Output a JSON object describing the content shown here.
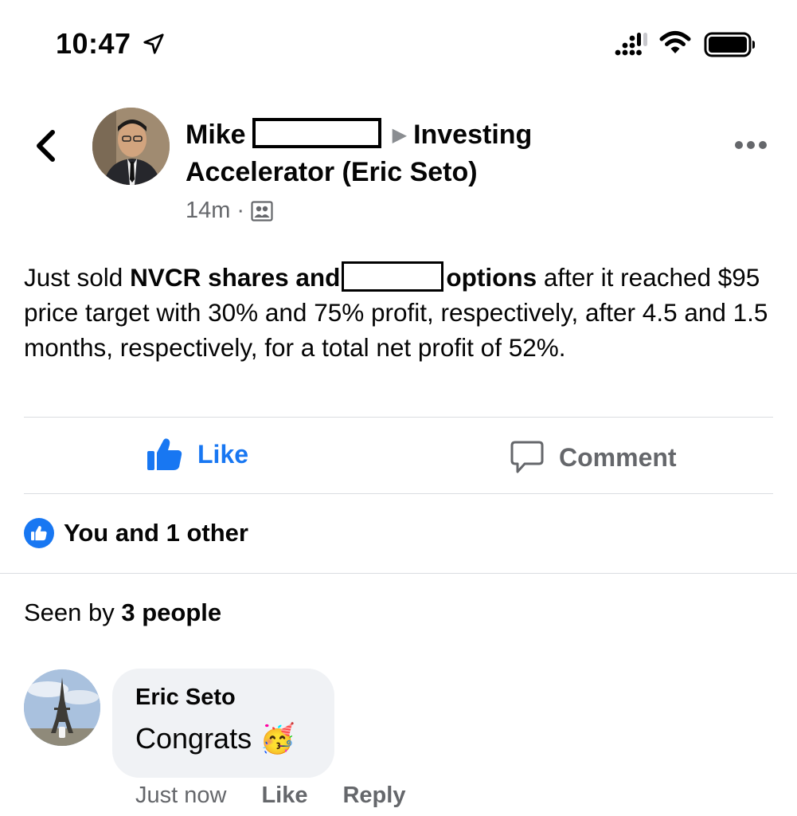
{
  "status_bar": {
    "time": "10:47",
    "icons": [
      "location-arrow-icon",
      "signal-icon",
      "wifi-icon",
      "battery-icon"
    ]
  },
  "post": {
    "author": "Mike",
    "group_part1": "Investing",
    "group_part2": "Accelerator (Eric Seto)",
    "timestamp": "14m",
    "separator": "·",
    "audience_icon": "group-icon",
    "text_1": "Just sold ",
    "text_bold_1": "NVCR shares and",
    "text_bold_2": "options",
    "text_2": " after it reached $95 price target with 30% and 75% profit, respectively, after 4.5 and 1.5 months, respectively, for a total net profit of 52%."
  },
  "actions": {
    "like_label": "Like",
    "comment_label": "Comment"
  },
  "reactions": {
    "summary": "You and 1 other"
  },
  "seen": {
    "prefix": "Seen by ",
    "count": "3 people"
  },
  "comment": {
    "author": "Eric Seto",
    "text": "Congrats",
    "emoji": "🥳",
    "time": "Just now",
    "like_label": "Like",
    "reply_label": "Reply"
  },
  "colors": {
    "accent": "#1877f2",
    "secondary_text": "#65676b",
    "bubble_bg": "#f0f2f5"
  }
}
